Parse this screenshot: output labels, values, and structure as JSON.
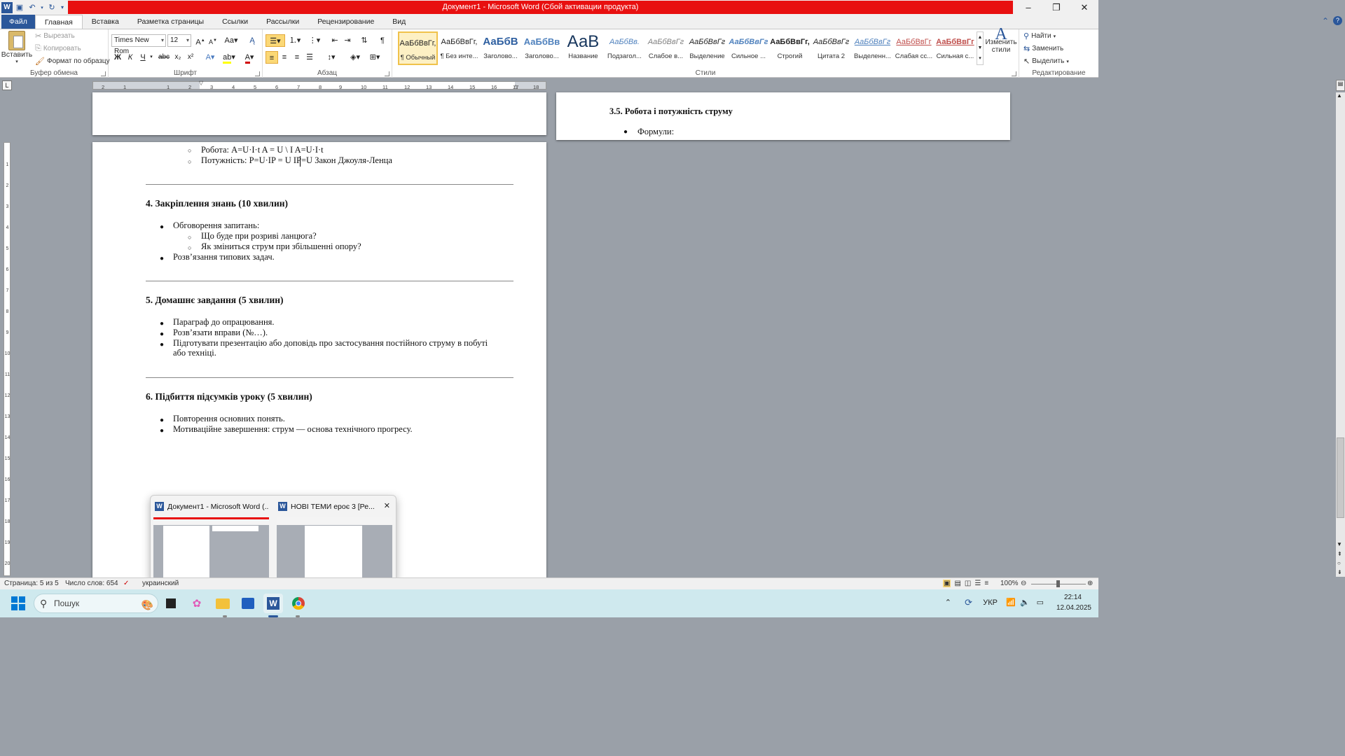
{
  "window": {
    "title": "Документ1  -  Microsoft Word (Сбой активации продукта)",
    "controls": [
      "–",
      "❐",
      "✕"
    ]
  },
  "qat": {
    "icons": [
      "word-icon",
      "save-icon",
      "undo-icon",
      "redo-icon",
      "customize-icon"
    ]
  },
  "tabs": [
    "Файл",
    "Главная",
    "Вставка",
    "Разметка страницы",
    "Ссылки",
    "Рассылки",
    "Рецензирование",
    "Вид"
  ],
  "ribbon": {
    "clipboard": {
      "label": "Буфер обмена",
      "paste": "Вставить",
      "cut": "Вырезать",
      "copy": "Копировать",
      "format_painter": "Формат по образцу"
    },
    "font": {
      "label": "Шрифт",
      "name": "Times New Rom",
      "size": "12"
    },
    "paragraph": {
      "label": "Абзац"
    },
    "styles": {
      "label": "Стили",
      "change": "Изменить стили",
      "items": [
        {
          "preview": "АаБбВвГг,",
          "name": "¶ Обычный"
        },
        {
          "preview": "АаБбВвГг,",
          "name": "¶ Без инте..."
        },
        {
          "preview": "АаБбВ",
          "name": "Заголово..."
        },
        {
          "preview": "АаБбВв",
          "name": "Заголово..."
        },
        {
          "preview": "АаВ",
          "name": "Название"
        },
        {
          "preview": "АаБбВв.",
          "name": "Подзагол..."
        },
        {
          "preview": "АаБбВвГг",
          "name": "Слабое в..."
        },
        {
          "preview": "АаБбВвГг",
          "name": "Выделение"
        },
        {
          "preview": "АаБбВвГг",
          "name": "Сильное ..."
        },
        {
          "preview": "АаБбВвГг,",
          "name": "Строгий"
        },
        {
          "preview": "АаБбВвГг",
          "name": "Цитата 2"
        },
        {
          "preview": "АаБбВвГг",
          "name": "Выделенн..."
        },
        {
          "preview": "АаБбВвГг",
          "name": "Слабая сс..."
        },
        {
          "preview": "АаБбВвГг",
          "name": "Сильная с..."
        }
      ]
    },
    "editing": {
      "label": "Редактирование",
      "find": "Найти",
      "replace": "Заменить",
      "select": "Выделить"
    }
  },
  "ruler": {
    "h_ticks": [
      "2",
      "1",
      "1",
      "2",
      "3",
      "4",
      "5",
      "6",
      "7",
      "8",
      "9",
      "10",
      "11",
      "12",
      "13",
      "14",
      "15",
      "16",
      "17",
      "18"
    ],
    "v_ticks": [
      "1",
      "2",
      "3",
      "4",
      "5",
      "6",
      "7",
      "8",
      "9",
      "10",
      "11",
      "12",
      "13",
      "14",
      "15",
      "16",
      "17",
      "18",
      "19",
      "20"
    ]
  },
  "doc": {
    "right_page": {
      "heading": "3.5. Робота і потужність струму",
      "bullet": "Формули:"
    },
    "main": {
      "formula1": "Робота: A=U·I·t A = U \\ I  A=U·I·t",
      "formula2": "Потужність: P=U·IP = U  IP=U Закон Джоуля-Ленца",
      "h4": "4. Закріплення знань (10 хвилин)",
      "h4_b1": "Обговорення запитань:",
      "h4_s1": "Що буде при розриві ланцюга?",
      "h4_s2": "Як зміниться струм при збільшенні опору?",
      "h4_b2": "Розв’язання типових задач.",
      "h5": "5. Домашнє завдання (5 хвилин)",
      "h5_b1": "Параграф до опрацювання.",
      "h5_b2": "Розв’язати вправи (№…).",
      "h5_b3a": "Підготувати презентацію або доповідь про застосування постійного струму в побуті",
      "h5_b3b": "або техніці.",
      "h6": "6. Підбиття підсумків уроку (5 хвилин)",
      "h6_b1": "Повторення основних понять.",
      "h6_b2": "Мотиваційне завершення: струм — основа технічного прогресу."
    }
  },
  "popup": {
    "items": [
      {
        "title": "Документ1 - Microsoft Word (..."
      },
      {
        "title": "НОВІ ТЕМИ ероє 3 [Ре..."
      }
    ]
  },
  "status": {
    "page": "Страница: 5 из 5",
    "words": "Число слов: 654",
    "lang": "украинский",
    "zoom": "100%"
  },
  "taskbar": {
    "search": "Пошук",
    "lang": "УКР",
    "time": "22:14",
    "date": "12.04.2025"
  }
}
